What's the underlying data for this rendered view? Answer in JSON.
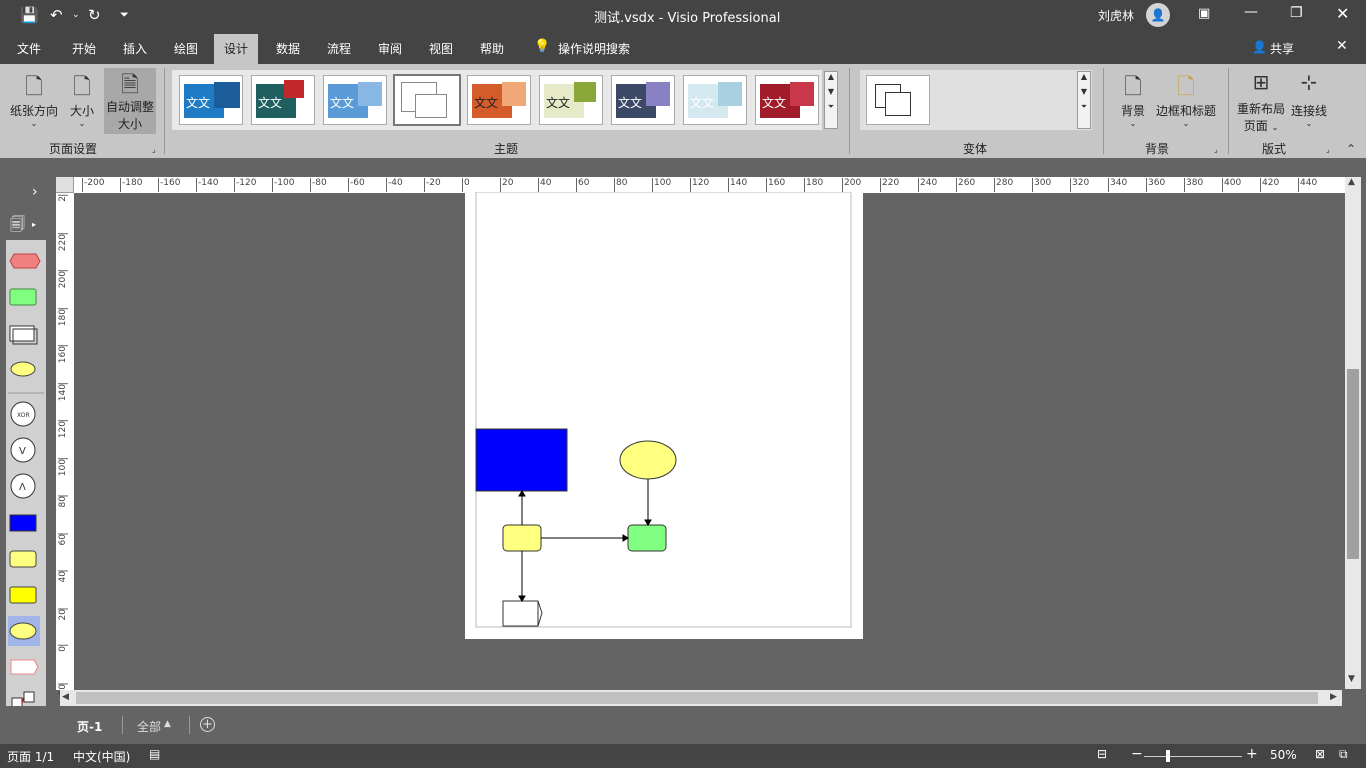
{
  "title": {
    "doc": "测试.vsdx  -  Visio Professional",
    "user": "刘虎林"
  },
  "tabs": [
    "文件",
    "开始",
    "插入",
    "绘图",
    "设计",
    "数据",
    "流程",
    "审阅",
    "视图",
    "帮助"
  ],
  "active_tab": "设计",
  "tell_me": "操作说明搜索",
  "share": "共享",
  "ribbon": {
    "page_setup": {
      "orientation": "纸张方向",
      "size": "大小",
      "autofit_l1": "自动调整",
      "autofit_l2": "大小",
      "group": "页面设置"
    },
    "themes_group": "主题",
    "theme_text": "文文",
    "variants_group": "变体",
    "background": "背景",
    "borders": "边框和标题",
    "background_group": "背景",
    "relayout_l1": "重新布局",
    "relayout_l2": "页面",
    "connectors": "连接线",
    "layout_group": "版式"
  },
  "ruler_top": [
    "-200",
    "-180",
    "-160",
    "-140",
    "-120",
    "-100",
    "-80",
    "-60",
    "-40",
    "-20",
    "0",
    "20",
    "40",
    "60",
    "80",
    "100",
    "120",
    "140",
    "160",
    "180",
    "200",
    "220",
    "240",
    "260",
    "280",
    "300",
    "320",
    "340",
    "360",
    "380",
    "400",
    "420",
    "440"
  ],
  "ruler_left": [
    "2",
    "220",
    "200",
    "180",
    "160",
    "140",
    "120",
    "100",
    "80",
    "60",
    "40",
    "20",
    "0",
    "20"
  ],
  "pages": {
    "page1": "页-1",
    "all": "全部"
  },
  "status": {
    "page": "页面 1/1",
    "lang": "中文(中国)",
    "zoom": "50%"
  },
  "colors": {
    "blue": "#0000ff",
    "yellow": "#ffff80",
    "green": "#80ff80"
  }
}
